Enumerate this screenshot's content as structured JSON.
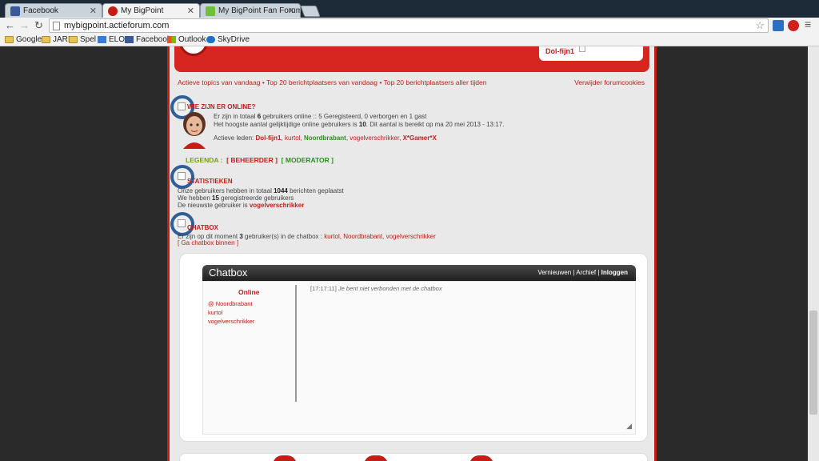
{
  "tabs": [
    {
      "label": "Facebook",
      "active": false
    },
    {
      "label": "My BigPoint",
      "active": true
    },
    {
      "label": "My BigPoint Fan Forum - ",
      "active": false
    }
  ],
  "address": {
    "url": "mybigpoint.actieforum.com"
  },
  "bookmarks": [
    "Google",
    "JARI",
    "Spel",
    "ELO",
    "Facebook",
    "Outlook",
    "SkyDrive"
  ],
  "page": {
    "top_user": "Dol-fijn1",
    "top_links": "Actieve topics van vandaag • Top 20 berichtplaatsers van vandaag • Top 20 berichtplaatsers aller tijden",
    "cookie_link": "Verwijder forumcookies",
    "online": {
      "title": "WIE ZIJN ER ONLINE?",
      "line1_a": "Er zijn in totaal ",
      "line1_count": "6",
      "line1_b": " gebruikers online :: 5 Geregisteerd, 0 verborgen en 1 gast",
      "line2_a": "Het hoogste aantal gelijktijdige online gebruikers is ",
      "line2_count": "10",
      "line2_b": ". Dit aantal is bereikt op ma 20 mei 2013 - 13:17.",
      "active_label": "Actieve leden: ",
      "active_users": [
        {
          "name": "Dol-fijn1",
          "style": "red"
        },
        {
          "name": "kurtol",
          "style": "plain"
        },
        {
          "name": "Noordbrabant",
          "style": "green"
        },
        {
          "name": "vogelverschrikker",
          "style": "plain"
        },
        {
          "name": "X*Gamer*X",
          "style": "red"
        }
      ]
    },
    "legenda": {
      "label": "LEGENDA :",
      "beheerder": "[ BEHEERDER ]",
      "moderator": "[ MODERATOR ]"
    },
    "stats": {
      "title": "STATISTIEKEN",
      "line1_a": "Onze gebruikers hebben in totaal ",
      "line1_count": "1044",
      "line1_b": " berichten geplaatst",
      "line2_a": "We hebben ",
      "line2_count": "15",
      "line2_b": " geregistreerde gebruikers",
      "line3_a": "De nieuwste gebruiker is ",
      "line3_user": "vogelverschrikker"
    },
    "chatbox_section": {
      "title": "CHATBOX",
      "line_a": "Er zijn op dit moment ",
      "line_count": "3",
      "line_b": " gebruiker(s) in de chatbox : ",
      "line_users": "kurtol, Noordbrabant, vogelverschrikker",
      "enter_link": "[ Ga chatbox binnen ]"
    },
    "chatbox": {
      "title": "Chatbox",
      "refresh": "Vernieuwen",
      "archive": "Archief",
      "login": "Inloggen",
      "online_title": "Online",
      "users": [
        "@ Noordbrabant",
        "kurtol",
        "vogelverschrikker"
      ],
      "message_time": "[17:17:11]",
      "message_text": "Je bent niet verbonden met de chatbox"
    }
  }
}
